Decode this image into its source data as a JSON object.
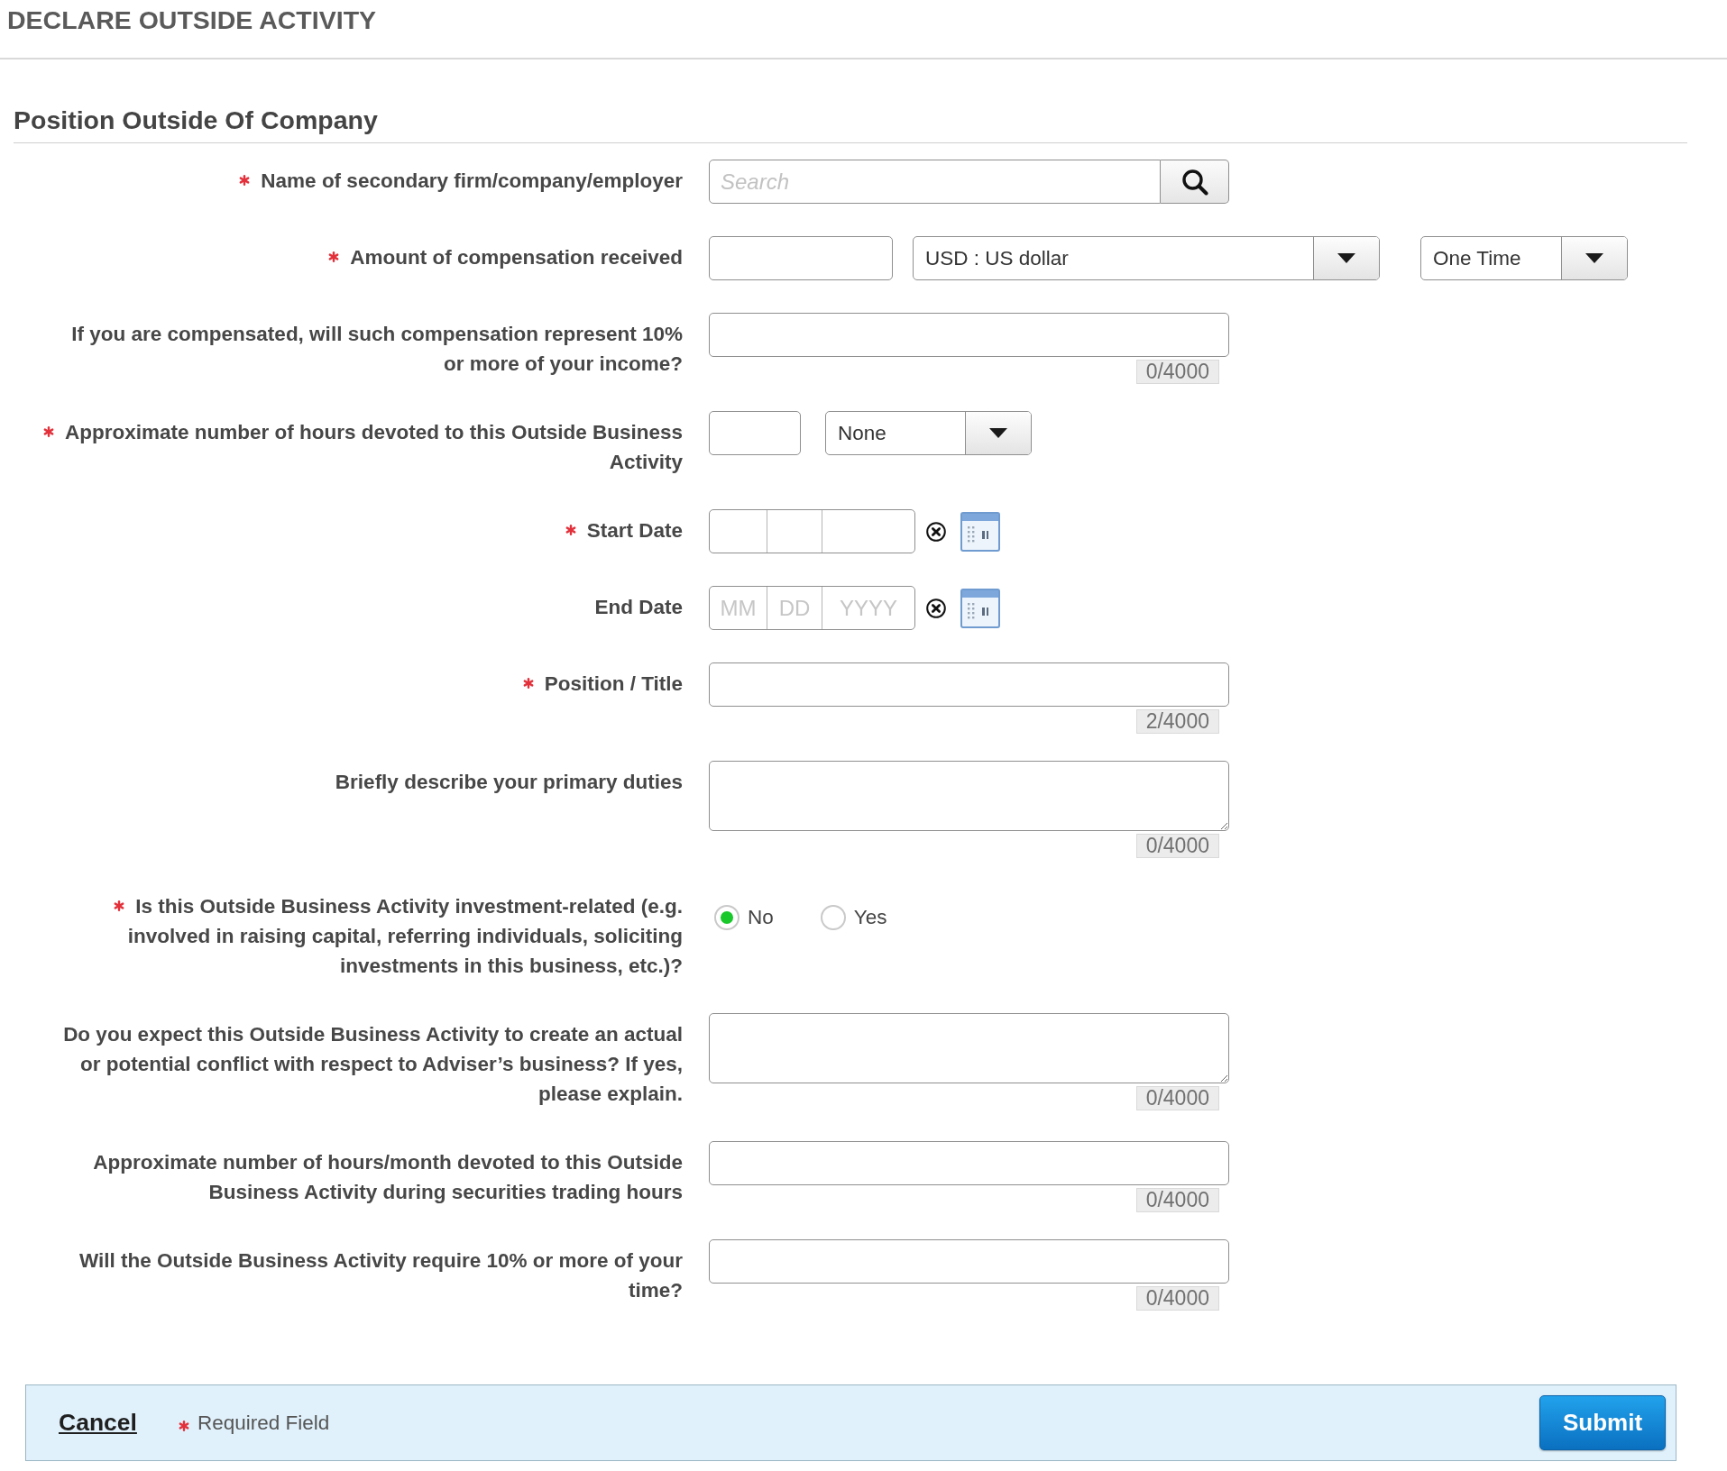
{
  "page": {
    "title": "DECLARE OUTSIDE ACTIVITY"
  },
  "section": {
    "title": "Position Outside Of Company"
  },
  "fields": [
    {
      "kind": "search",
      "label": "Name of secondary firm/company/employer",
      "required": true,
      "placeholder": "Search"
    },
    {
      "kind": "amount",
      "label": "Amount of compensation received",
      "required": true,
      "currency": "USD : US dollar",
      "frequency": "One Time"
    },
    {
      "kind": "text",
      "label": "If you are compensated, will such compensation represent 10% or more of your income?",
      "required": false,
      "counter": "0/4000"
    },
    {
      "kind": "hours",
      "label": "Approximate number of hours devoted to this Outside Business Activity",
      "required": true,
      "unit": "None"
    },
    {
      "kind": "date",
      "label": "Start Date",
      "required": true
    },
    {
      "kind": "date",
      "label": "End Date",
      "required": false,
      "segments": [
        {
          "placeholder": "MM"
        },
        {
          "placeholder": "DD"
        },
        {
          "placeholder": "YYYY"
        }
      ]
    },
    {
      "kind": "text",
      "label": "Position / Title",
      "required": true,
      "counter": "2/4000"
    },
    {
      "kind": "textarea",
      "label": "Briefly describe your primary duties",
      "required": false,
      "counter": "0/4000"
    },
    {
      "kind": "radio",
      "label": "Is this Outside Business Activity investment-related (e.g. involved in raising capital, referring individuals, soliciting investments in this business, etc.)?",
      "required": true,
      "options": [
        {
          "label": "No",
          "selected": true
        },
        {
          "label": "Yes",
          "selected": false
        }
      ]
    },
    {
      "kind": "textarea",
      "label": "Do you expect this Outside Business Activity to create an actual or potential conflict with respect to Adviser’s business? If yes, please explain.",
      "required": false,
      "counter": "0/4000"
    },
    {
      "kind": "text",
      "label": "Approximate number of hours/month devoted to this Outside Business Activity during securities trading hours",
      "required": false,
      "counter": "0/4000"
    },
    {
      "kind": "text",
      "label": "Will the Outside Business Activity require 10% or more of your time?",
      "required": false,
      "counter": "0/4000"
    }
  ],
  "footer": {
    "cancel": "Cancel",
    "legend": "Required Field",
    "submit": "Submit"
  }
}
